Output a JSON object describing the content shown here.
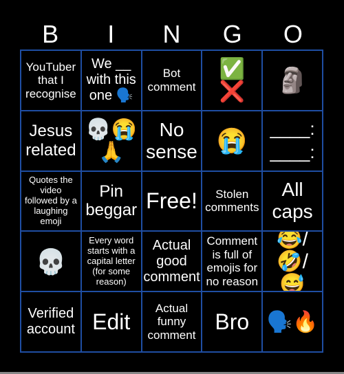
{
  "header": [
    "B",
    "I",
    "N",
    "G",
    "O"
  ],
  "cells": [
    "YouTuber that I recognise",
    "We __ with this one 🗣️",
    "Bot comment",
    "✅\n❌",
    "🗿",
    "Jesus related",
    "💀😭🙏",
    "No sense",
    "😭",
    "____:\n____:",
    "Quotes the video followed by a laughing emoji",
    "Pin beggar",
    "Free!",
    "Stolen comments",
    "All caps",
    "💀",
    "Every word starts with a capital letter (for some reason)",
    "Actual good comment",
    "Comment is full of emojis for no reason",
    "😂/🤣/😅",
    "Verified account",
    "Edit",
    "Actual funny comment",
    "Bro",
    "🗣️🔥"
  ],
  "colors": {
    "background": "#000000",
    "border": "#1f4ea3",
    "text": "#ffffff"
  }
}
